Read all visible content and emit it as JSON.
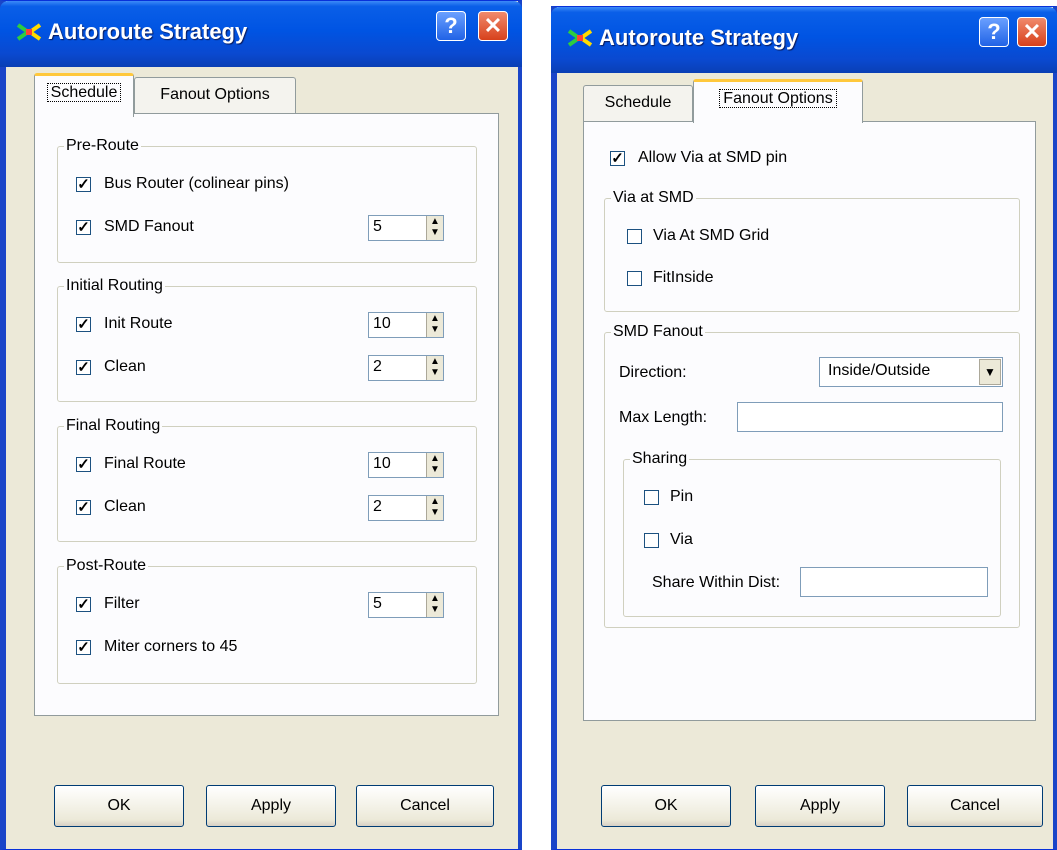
{
  "left_dialog": {
    "title": "Autoroute Strategy",
    "tabs": [
      "Schedule",
      "Fanout Options"
    ],
    "groups": {
      "pre_route": {
        "title": "Pre-Route",
        "bus_router": {
          "label": "Bus Router (colinear pins)",
          "checked": true
        },
        "smd_fanout": {
          "label": "SMD Fanout",
          "checked": true,
          "value": "5"
        }
      },
      "initial_routing": {
        "title": "Initial Routing",
        "init_route": {
          "label": "Init Route",
          "checked": true,
          "value": "10"
        },
        "clean": {
          "label": "Clean",
          "checked": true,
          "value": "2"
        }
      },
      "final_routing": {
        "title": "Final Routing",
        "final_route": {
          "label": "Final Route",
          "checked": true,
          "value": "10"
        },
        "clean": {
          "label": "Clean",
          "checked": true,
          "value": "2"
        }
      },
      "post_route": {
        "title": "Post-Route",
        "filter": {
          "label": "Filter",
          "checked": true,
          "value": "5"
        },
        "miter": {
          "label": "Miter corners to 45",
          "checked": true
        }
      }
    },
    "buttons": {
      "ok": "OK",
      "apply": "Apply",
      "cancel": "Cancel"
    }
  },
  "right_dialog": {
    "title": "Autoroute Strategy",
    "tabs": [
      "Schedule",
      "Fanout Options"
    ],
    "allow_via": {
      "label": "Allow Via at SMD pin",
      "checked": true
    },
    "via_at_smd": {
      "title": "Via at SMD",
      "grid": {
        "label": "Via At SMD Grid",
        "checked": false
      },
      "fit_inside": {
        "label": "FitInside",
        "checked": false
      }
    },
    "smd_fanout": {
      "title": "SMD Fanout",
      "direction_label": "Direction:",
      "direction_value": "Inside/Outside",
      "max_length_label": "Max Length:",
      "max_length_value": "",
      "sharing": {
        "title": "Sharing",
        "pin": {
          "label": "Pin",
          "checked": false
        },
        "via": {
          "label": "Via",
          "checked": false
        },
        "share_within_label": "Share Within Dist:",
        "share_within_value": ""
      }
    },
    "buttons": {
      "ok": "OK",
      "apply": "Apply",
      "cancel": "Cancel"
    }
  },
  "icons": {
    "help": "?",
    "close": "✕",
    "check": "✓"
  },
  "colors": {
    "titlebar": "#0054e3",
    "dialog_bg": "#ece9d8",
    "panel_bg": "#fcfcfe"
  }
}
